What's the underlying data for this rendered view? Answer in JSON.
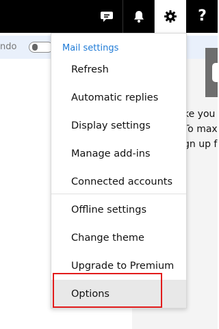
{
  "header": {
    "buttons": [
      {
        "name": "feedback",
        "icon": "speech-bubble-icon"
      },
      {
        "name": "notifications",
        "icon": "bell-icon"
      },
      {
        "name": "settings",
        "icon": "gear-icon",
        "active": true
      },
      {
        "name": "help",
        "icon": "question-mark-icon",
        "glyph": "?"
      }
    ]
  },
  "background": {
    "clipped_text": "ndo",
    "right_panel_lines": [
      "ke you",
      "To max",
      "gn up f"
    ]
  },
  "menu": {
    "header": "Mail settings",
    "items": [
      "Refresh",
      "Automatic replies",
      "Display settings",
      "Manage add-ins",
      "Connected accounts",
      "Offline settings",
      "Change theme",
      "Upgrade to Premium",
      "Options"
    ]
  },
  "colors": {
    "header_bg": "#000000",
    "accent": "#1e7ad6",
    "highlight_border": "#e21b1b"
  }
}
